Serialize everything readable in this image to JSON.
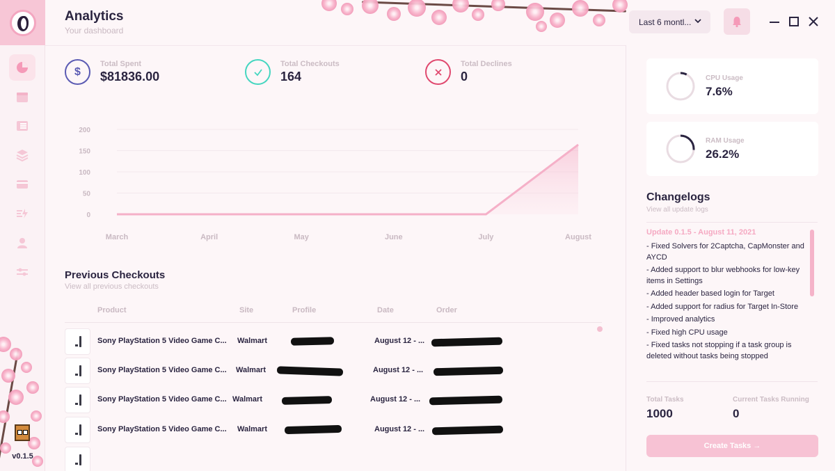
{
  "app": {
    "version": "v0.1.5"
  },
  "header": {
    "title": "Analytics",
    "subtitle": "Your dashboard",
    "range_select": "Last 6 montl..."
  },
  "sidebar": {
    "items": [
      {
        "icon": "pie-chart-icon",
        "active": true
      },
      {
        "icon": "calendar-icon",
        "active": false
      },
      {
        "icon": "list-icon",
        "active": false
      },
      {
        "icon": "layers-icon",
        "active": false
      },
      {
        "icon": "credit-card-icon",
        "active": false
      },
      {
        "icon": "tasks-bolt-icon",
        "active": false
      },
      {
        "icon": "user-icon",
        "active": false
      },
      {
        "icon": "sliders-icon",
        "active": false
      }
    ]
  },
  "stats": {
    "spent": {
      "label": "Total Spent",
      "value": "$81836.00",
      "icon": "dollar-icon",
      "color": "#5b5bb3"
    },
    "checkouts": {
      "label": "Total Checkouts",
      "value": "164",
      "icon": "check-icon",
      "color": "#45d6c0"
    },
    "declines": {
      "label": "Total Declines",
      "value": "0",
      "icon": "x-icon",
      "color": "#e0496f"
    }
  },
  "chart_data": {
    "type": "area",
    "categories": [
      "March",
      "April",
      "May",
      "June",
      "July",
      "August"
    ],
    "values": [
      0,
      0,
      0,
      0,
      0,
      164
    ],
    "title": "",
    "xlabel": "",
    "ylabel": "",
    "ylim": [
      0,
      200
    ],
    "yticks": [
      "200",
      "150",
      "100",
      "50",
      "0"
    ],
    "grid": true,
    "color": "#f5b0c8"
  },
  "checkouts": {
    "title": "Previous Checkouts",
    "subtitle": "View all previous checkouts",
    "columns": [
      "Product",
      "Site",
      "Profile",
      "Date",
      "Order"
    ],
    "rows": [
      {
        "product": "Sony PlayStation 5 Video Game C...",
        "site": "Walmart",
        "date": "August 12 - ..."
      },
      {
        "product": "Sony PlayStation 5 Video Game C...",
        "site": "Walmart",
        "date": "August 12 - ..."
      },
      {
        "product": "Sony PlayStation 5 Video Game C...",
        "site": "Walmart",
        "date": "August 12 - ..."
      },
      {
        "product": "Sony PlayStation 5 Video Game C...",
        "site": "Walmart",
        "date": "August 12 - ..."
      }
    ]
  },
  "system": {
    "cpu": {
      "label": "CPU Usage",
      "value": "7.6%",
      "fraction": 0.076
    },
    "ram": {
      "label": "RAM Usage",
      "value": "26.2%",
      "fraction": 0.262
    }
  },
  "changelogs": {
    "title": "Changelogs",
    "subtitle": "View all update logs",
    "update_title": "Update 0.1.5 - August 11, 2021",
    "entries": [
      "- Fixed Solvers for 2Captcha, CapMonster and AYCD",
      "- Added support to blur webhooks for low-key items in Settings",
      "- Added header based login for Target",
      "- Added support for radius for Target In-Store",
      "- Improved analytics",
      "- Fixed high CPU usage",
      "- Fixed tasks not stopping if a task group is deleted without tasks being stopped"
    ]
  },
  "tasks": {
    "total_label": "Total Tasks",
    "total_value": "1000",
    "running_label": "Current Tasks Running",
    "running_value": "0",
    "create_button": "Create Tasks →"
  },
  "colors": {
    "accent": "#f5a9c2",
    "background": "#fdf6f8",
    "text": "#2a2440",
    "muted": "#cbbcc4"
  }
}
